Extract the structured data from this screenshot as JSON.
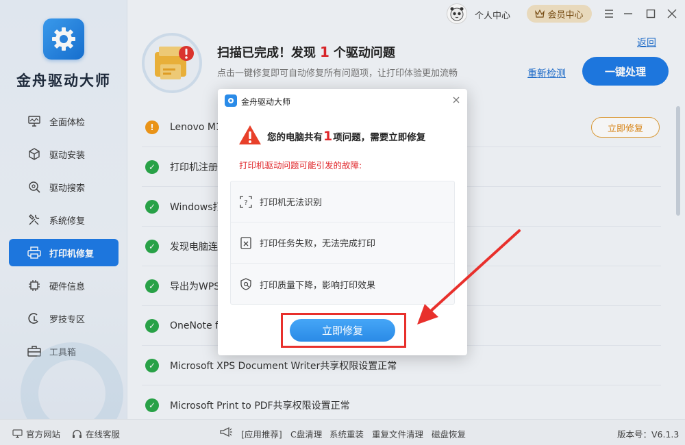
{
  "app": {
    "name": "金舟驱动大师",
    "colors": {
      "primary": "#1f7be6",
      "warning": "#e0262a",
      "success": "#2aa84a"
    }
  },
  "sidebar": {
    "items": [
      {
        "label": "全面体检",
        "icon": "monitor-icon",
        "active": false
      },
      {
        "label": "驱动安装",
        "icon": "box-icon",
        "active": false
      },
      {
        "label": "驱动搜索",
        "icon": "search-gear-icon",
        "active": false
      },
      {
        "label": "系统修复",
        "icon": "wrench-icon",
        "active": false
      },
      {
        "label": "打印机修复",
        "icon": "printer-icon",
        "active": true
      },
      {
        "label": "硬件信息",
        "icon": "chip-icon",
        "active": false
      },
      {
        "label": "罗技专区",
        "icon": "logitech-icon",
        "active": false
      },
      {
        "label": "工具箱",
        "icon": "toolbox-icon",
        "active": false
      }
    ]
  },
  "topbar": {
    "personal": "个人中心",
    "vip": "会员中心"
  },
  "header": {
    "title_pre": "扫描已完成！发现",
    "title_count": "1",
    "title_post": "个驱动问题",
    "subtitle": "点击一键修复即可自动修复所有问题项，让打印体验更加流畅",
    "back": "返回",
    "recheck": "重新检测",
    "fix_all": "一键处理"
  },
  "list": {
    "rows": [
      {
        "text": "Lenovo M16",
        "status": "warn",
        "action": "立即修复"
      },
      {
        "text": "打印机注册表",
        "status": "ok"
      },
      {
        "text": "Windows打印",
        "status": "ok"
      },
      {
        "text": "发现电脑连接",
        "status": "ok"
      },
      {
        "text": "导出为WPS",
        "status": "ok"
      },
      {
        "text": "OneNote fo",
        "status": "ok"
      },
      {
        "text": "Microsoft XPS Document Writer共享权限设置正常",
        "status": "ok"
      },
      {
        "text": "Microsoft Print to PDF共享权限设置正常",
        "status": "ok"
      }
    ]
  },
  "footer": {
    "website": "官方网站",
    "service": "在线客服",
    "recommend": "[应用推荐]",
    "links": [
      "C盘清理",
      "系统重装",
      "重复文件清理",
      "磁盘恢复"
    ],
    "version": "版本号：V6.1.3"
  },
  "dialog": {
    "title": "金舟驱动大师",
    "head_pre": "您的电脑共有",
    "head_count": "1",
    "head_post": "项问题，需要立即修复",
    "sub": "打印机驱动问题可能引发的故障:",
    "issues": [
      {
        "label": "打印机无法识别",
        "icon": "unknown-device-icon"
      },
      {
        "label": "打印任务失败，无法完成打印",
        "icon": "failed-doc-icon"
      },
      {
        "label": "打印质量下降，影响打印效果",
        "icon": "quality-shield-icon"
      }
    ],
    "fix_button": "立即修复"
  }
}
